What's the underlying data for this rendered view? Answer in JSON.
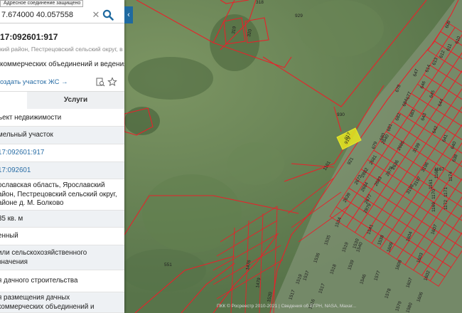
{
  "tooltip": "Адресное соединение защищено",
  "search": {
    "value": "7.674000 40.057558"
  },
  "parcel": {
    "cad_number": "17:092601:917",
    "address_short": "кий район, Пестрецовский сельский округ, в",
    "purpose_short": "коммерческих объединений и ведения",
    "create_link": "оздать участок ЖС →"
  },
  "tabs": {
    "services": "Услуги"
  },
  "rows": [
    {
      "text": "ъект недвижимости"
    },
    {
      "text": "мельный участок"
    },
    {
      "text": "17:092601:917"
    },
    {
      "text": "17:092601"
    },
    {
      "text": "ославская область, Ярославский\nайон, Пестрецовский сельский округ,\nайоне д. М. Болково"
    },
    {
      "text": "35 кв. м"
    },
    {
      "text": "енный"
    },
    {
      "text": "или сельскохозяйственного\nзначения"
    },
    {
      "text": "я дачного строительства"
    },
    {
      "text": "я размещения дачных\nкоммерческих объединений и"
    }
  ],
  "map": {
    "selected_parcel": "917",
    "labels": [
      "318",
      "929",
      "319",
      "320",
      "930",
      "921",
      "919",
      "1161",
      "2882",
      "2681",
      "2640",
      "2685",
      "3199",
      "3196",
      "1167",
      "1168",
      "1174",
      "3198",
      "2684",
      "2683",
      "2678",
      "2636",
      "1170",
      "1171",
      "1161",
      "1172",
      "1169",
      "3197",
      "2672",
      "2677",
      "551",
      "1476",
      "1479",
      "1520",
      "2639",
      "2879",
      "1519",
      "1518",
      "1517",
      "1516",
      "1530",
      "1604",
      "1603",
      "1602",
      "1541",
      "1540",
      "1539",
      "1609",
      "1608",
      "1607",
      "1606",
      "1519",
      "1538",
      "1534",
      "1535",
      "1536",
      "1537",
      "1546",
      "1577",
      "1578",
      "1579",
      "1580",
      "1517",
      "1607",
      "614",
      "613",
      "612",
      "611",
      "610",
      "609",
      "647",
      "646",
      "645",
      "644",
      "643",
      "642",
      "641",
      "640",
      "638",
      "684",
      "683",
      "682",
      "681",
      "680",
      "679",
      "678",
      "677"
    ],
    "colors": {
      "parcel": "#e8212a",
      "selected": "#e6e61e",
      "accent": "#1f6aa0"
    }
  },
  "footer": "ПКК © Росреестр 2010-2021 | Сведения об ЕГРН, NASA, Maxar..."
}
